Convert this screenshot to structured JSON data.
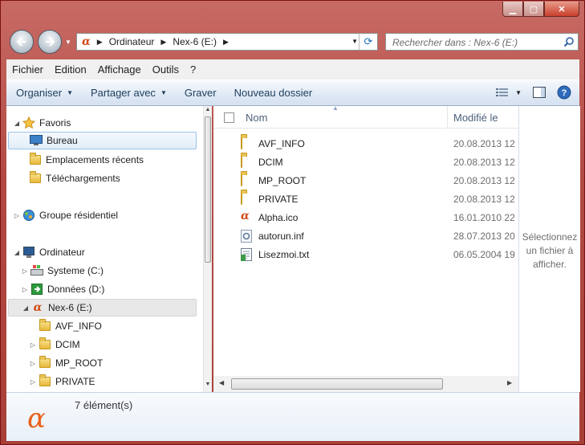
{
  "window": {
    "controls": {
      "minimize": "▁",
      "maximize": "▢",
      "close": "✕"
    }
  },
  "address": {
    "crumbs": [
      "Ordinateur",
      "Nex-6 (E:)"
    ]
  },
  "search": {
    "placeholder": "Rechercher dans : Nex-6 (E:)"
  },
  "menu": [
    "Fichier",
    "Edition",
    "Affichage",
    "Outils",
    "?"
  ],
  "commands": {
    "organize": "Organiser",
    "share": "Partager avec",
    "burn": "Graver",
    "new_folder": "Nouveau dossier"
  },
  "nav": {
    "favorites": "Favoris",
    "desktop": "Bureau",
    "recent": "Emplacements récents",
    "downloads": "Téléchargements",
    "homegroup": "Groupe résidentiel",
    "computer": "Ordinateur",
    "system": "Systeme (C:)",
    "data": "Données (D:)",
    "drive": "Nex-6 (E:)",
    "sub": [
      "AVF_INFO",
      "DCIM",
      "MP_ROOT",
      "PRIVATE"
    ]
  },
  "columns": {
    "name": "Nom",
    "modified": "Modifié le"
  },
  "files": [
    {
      "name": "AVF_INFO",
      "date": "20.08.2013 12",
      "icon": "folder-icon"
    },
    {
      "name": "DCIM",
      "date": "20.08.2013 12",
      "icon": "folder-icon"
    },
    {
      "name": "MP_ROOT",
      "date": "20.08.2013 12",
      "icon": "folder-icon"
    },
    {
      "name": "PRIVATE",
      "date": "20.08.2013 12",
      "icon": "folder-icon"
    },
    {
      "name": "Alpha.ico",
      "date": "16.01.2010 22",
      "icon": "alpha-icon"
    },
    {
      "name": "autorun.inf",
      "date": "28.07.2013 20",
      "icon": "settings-file-icon"
    },
    {
      "name": "Lisezmoi.txt",
      "date": "06.05.2004 19",
      "icon": "text-file-icon"
    }
  ],
  "preview": {
    "line1": "Sélectionnez",
    "line2": "un fichier à",
    "line3": "afficher."
  },
  "details": {
    "count": "7 élément(s)",
    "glyph": "α"
  },
  "colors": {
    "titlebar": "#b24a44",
    "accent": "#1d6fb8",
    "alpha": "#e8621c"
  }
}
